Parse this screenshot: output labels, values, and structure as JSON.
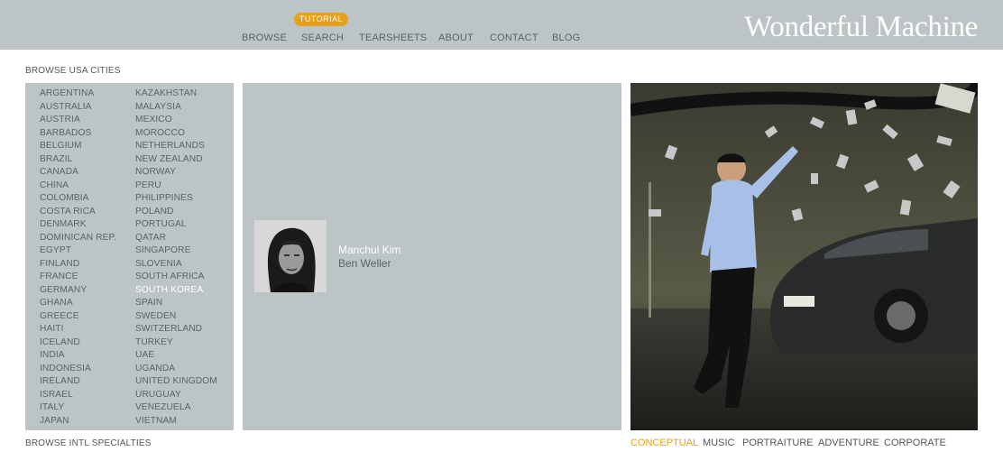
{
  "header": {
    "logo": "Wonderful Machine",
    "tutorial_badge": "TUTORIAL",
    "nav": [
      "BROWSE",
      "SEARCH",
      "TEARSHEETS",
      "ABOUT",
      "CONTACT",
      "BLOG"
    ]
  },
  "labels": {
    "browse_usa": "BROWSE USA CITIES",
    "browse_intl": "BROWSE INTL SPECIALTIES"
  },
  "countries": {
    "left": [
      "ARGENTINA",
      "AUSTRALIA",
      "AUSTRIA",
      "BARBADOS",
      "BELGIUM",
      "BRAZIL",
      "CANADA",
      "CHINA",
      "COLOMBIA",
      "COSTA RICA",
      "DENMARK",
      "DOMINICAN REP.",
      "EGYPT",
      "FINLAND",
      "FRANCE",
      "GERMANY",
      "GHANA",
      "GREECE",
      "HAITI",
      "ICELAND",
      "INDIA",
      "INDONESIA",
      "IRELAND",
      "ISRAEL",
      "ITALY",
      "JAPAN"
    ],
    "right": [
      "KAZAKHSTAN",
      "MALAYSIA",
      "MEXICO",
      "MOROCCO",
      "NETHERLANDS",
      "NEW ZEALAND",
      "NORWAY",
      "PERU",
      "PHILIPPINES",
      "POLAND",
      "PORTUGAL",
      "QATAR",
      "SINGAPORE",
      "SLOVENIA",
      "SOUTH AFRICA",
      "SOUTH KOREA",
      "SPAIN",
      "SWEDEN",
      "SWITZERLAND",
      "TURKEY",
      "UAE",
      "UGANDA",
      "UNITED KINGDOM",
      "URUGUAY",
      "VENEZUELA",
      "VIETNAM"
    ],
    "selected": "SOUTH KOREA"
  },
  "photographer": {
    "name": "Manchul Kim",
    "rep": "Ben Weller"
  },
  "specialties": {
    "items": [
      "CONCEPTUAL",
      "MUSIC",
      "PORTRAITURE",
      "ADVENTURE",
      "CORPORATE"
    ],
    "selected": "CONCEPTUAL"
  },
  "colors": {
    "panel": "#bcc4c5",
    "accent": "#e7a01a"
  }
}
